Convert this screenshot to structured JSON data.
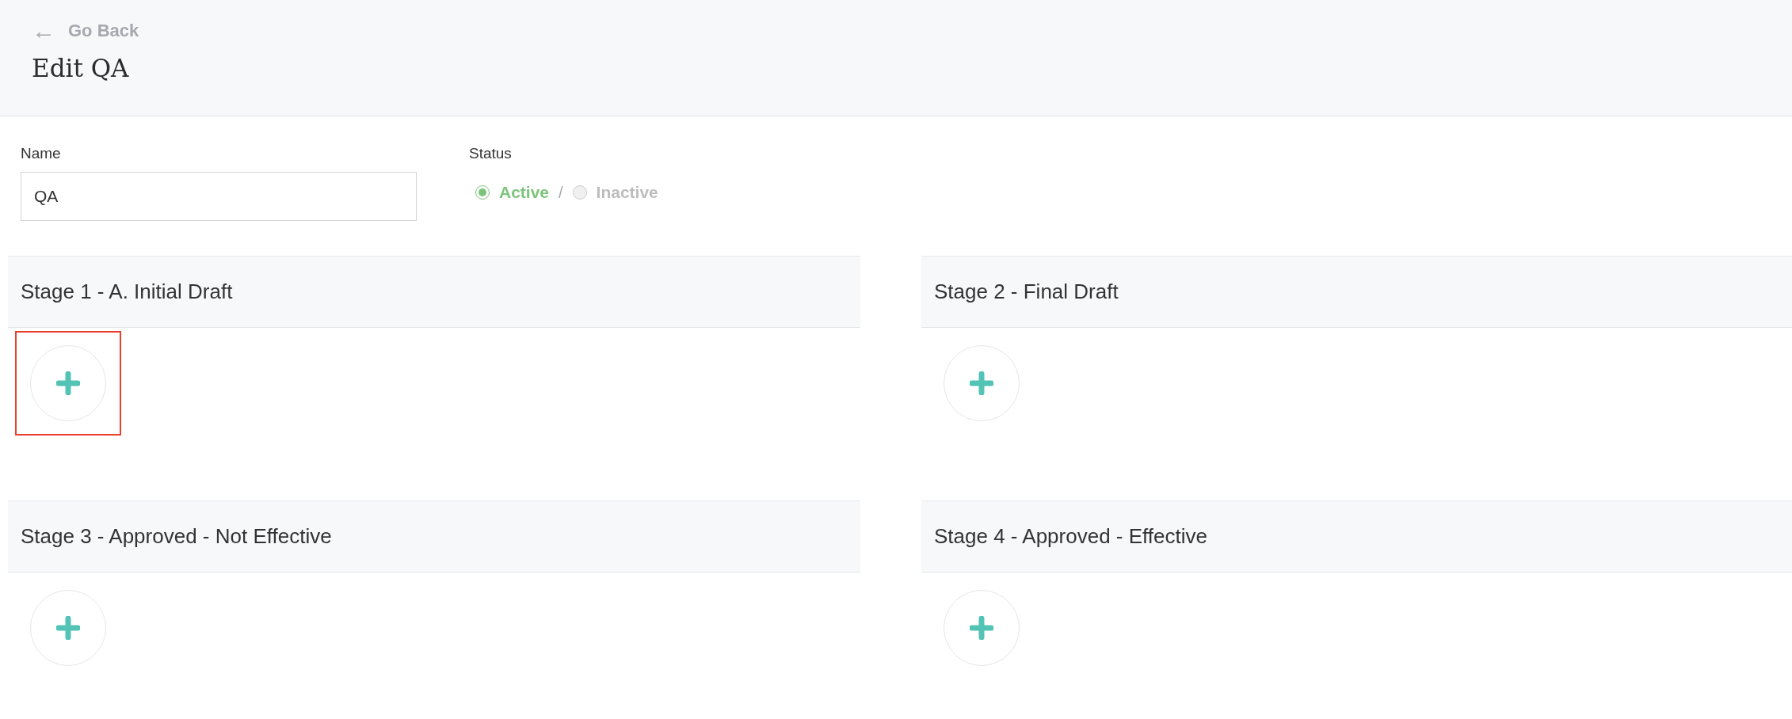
{
  "back_link": {
    "icon": "←",
    "label": "Go Back"
  },
  "page_title": "Edit QA",
  "name_field": {
    "label": "Name",
    "value": "QA"
  },
  "status": {
    "label": "Status",
    "separator": "/",
    "options": [
      {
        "label": "Active",
        "selected": true
      },
      {
        "label": "Inactive",
        "selected": false
      }
    ]
  },
  "stages": [
    {
      "title": "Stage 1 - A. Initial Draft",
      "highlighted": true
    },
    {
      "title": "Stage 2 - Final Draft",
      "highlighted": false
    },
    {
      "title": "Stage 3 - Approved - Not Effective",
      "highlighted": false
    },
    {
      "title": "Stage 4 - Approved - Effective",
      "highlighted": false
    }
  ]
}
